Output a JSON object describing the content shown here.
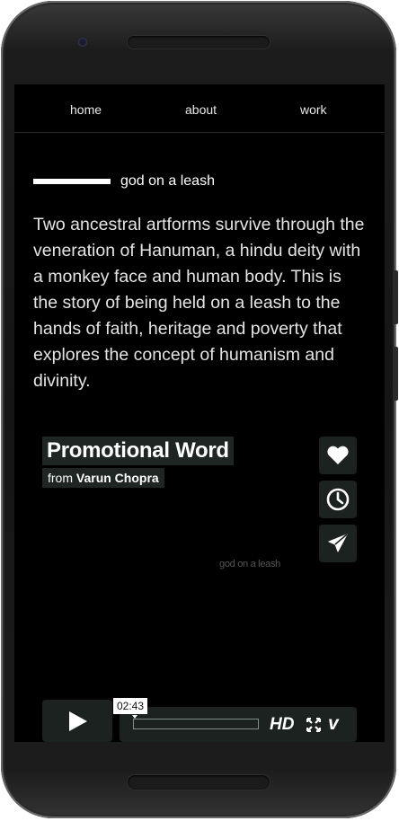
{
  "nav": {
    "items": [
      "home",
      "about",
      "work"
    ]
  },
  "project": {
    "heading": "god on a leash",
    "description": "Two ancestral artforms survive through the veneration of Hanuman, a hindu deity with a monkey face and human body. This is the story of being held on a leash to the hands of faith, heritage and poverty that explores the concept of humanism and divinity."
  },
  "video": {
    "title": "Promotional Word",
    "byline_prefix": "from",
    "author": "Varun Chopra",
    "watermark": "god on a leash",
    "side_buttons": [
      "heart-icon",
      "clock-icon",
      "send-icon"
    ],
    "timecode": "02:43",
    "progress": 0.0,
    "hd_label": "HD",
    "vimeo_label": "v",
    "colors": {
      "control_bg": "#1c2220",
      "progress": "#7f8c89"
    }
  }
}
